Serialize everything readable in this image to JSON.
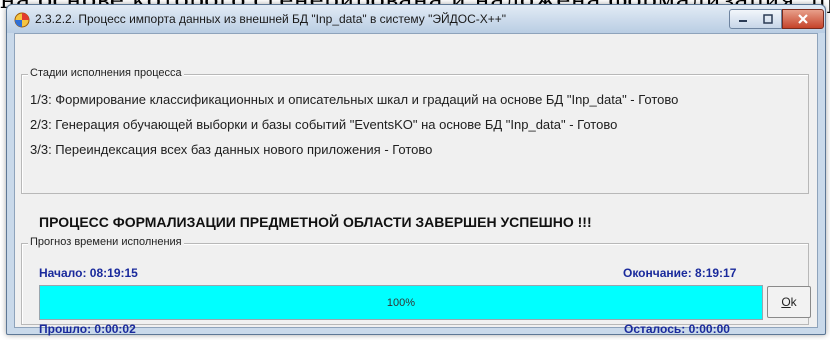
{
  "background_text": "на основе которого сгенерирована и наложена формализация, просмотр предметной области",
  "window": {
    "title": "2.3.2.2. Процесс импорта данных из внешней БД \"Inp_data\" в систему \"ЭЙДОС-X++\"",
    "controls": {
      "minimize_icon": "minimize-icon",
      "maximize_icon": "maximize-icon",
      "close_icon": "close-icon"
    }
  },
  "stages": {
    "legend": "Стадии исполнения процесса",
    "items": [
      "1/3: Формирование классификационных и описательных шкал и градаций на основе БД \"Inp_data\" - Готово",
      "2/3: Генерация обучающей выборки и базы событий \"EventsKO\" на основе БД \"Inp_data\" - Готово",
      "3/3: Переиндексация всех баз данных нового приложения - Готово"
    ]
  },
  "completion_message": "ПРОЦЕСС ФОРМАЛИЗАЦИИ ПРЕДМЕТНОЙ ОБЛАСТИ ЗАВЕРШЕН УСПЕШНО !!!",
  "forecast": {
    "legend": "Прогноз времени исполнения",
    "start": "Начало: 08:19:15",
    "end": "Окончание: 8:19:17",
    "elapsed": "Прошло: 0:00:02",
    "remaining": "Осталось: 0:00:00",
    "progress_percent": 100,
    "progress_label": "100%",
    "progress_color": "#00ffff"
  },
  "ok_button": {
    "mnemonic": "O",
    "rest": "k"
  },
  "colors": {
    "time_text": "#1a2a9c",
    "window_frame": "#c9d9ea"
  }
}
